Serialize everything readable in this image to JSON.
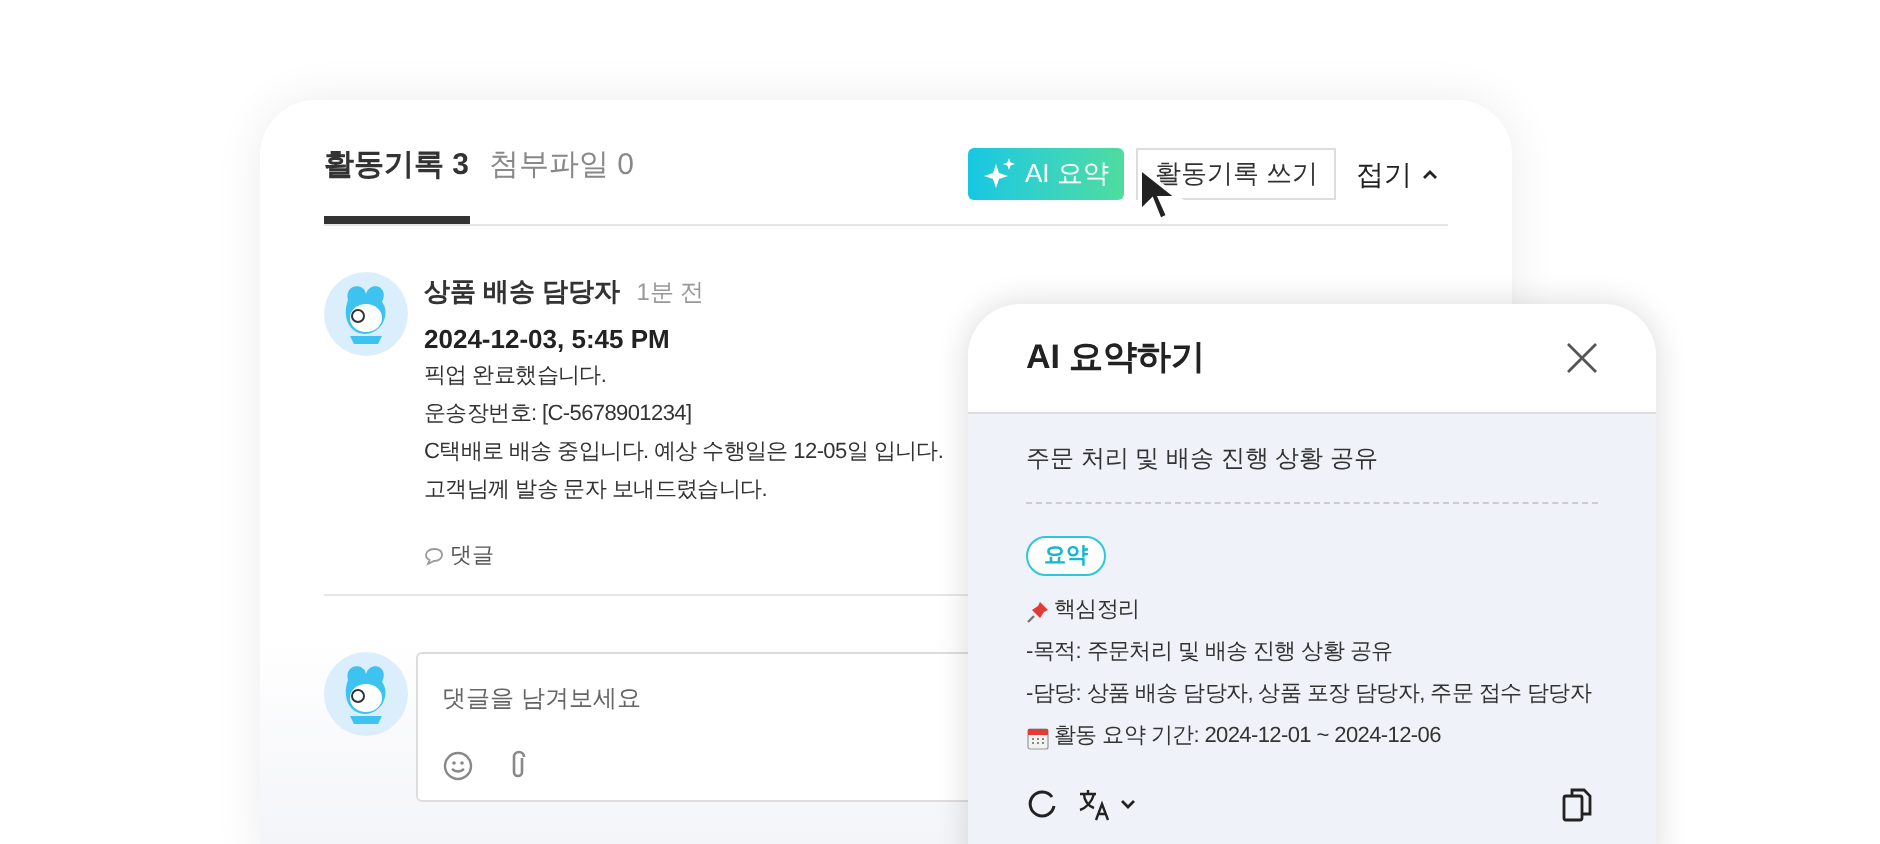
{
  "tabs": [
    {
      "label": "활동기록 3",
      "selected": true
    },
    {
      "label": "첨부파일 0",
      "selected": false
    }
  ],
  "toolbar": {
    "ai_button": "AI 요약",
    "write_button": "활동기록 쓰기",
    "collapse": "접기"
  },
  "activity": {
    "author": "상품 배송 담당자",
    "time": "1분 전",
    "date": "2024-12-03, 5:45 PM",
    "lines": [
      "픽업 완료했습니다.",
      "운송장번호: [C-5678901234]",
      "C택배로 배송 중입니다. 예상 수행일은 12-05일 입니다.",
      "고객님께 발송 문자 보내드렸습니다."
    ],
    "comment_link": "댓글"
  },
  "comment_box": {
    "placeholder": "댓글을 남겨보세요"
  },
  "ai_panel": {
    "title": "AI 요약하기",
    "subject": "주문 처리 및 배송 진행 상황 공유",
    "tag": "요약",
    "lines": [
      {
        "kind": "pin",
        "text": "핵심정리"
      },
      {
        "kind": "plain",
        "text": "-목적: 주문처리 및 배송 진행 상황 공유"
      },
      {
        "kind": "plain",
        "text": "-담당: 상품 배송 담당자, 상품 포장 담당자, 주문 접수 담당자"
      },
      {
        "kind": "calendar",
        "text": "활동 요약 기간: 2024-12-01 ~ 2024-12-06"
      }
    ]
  }
}
